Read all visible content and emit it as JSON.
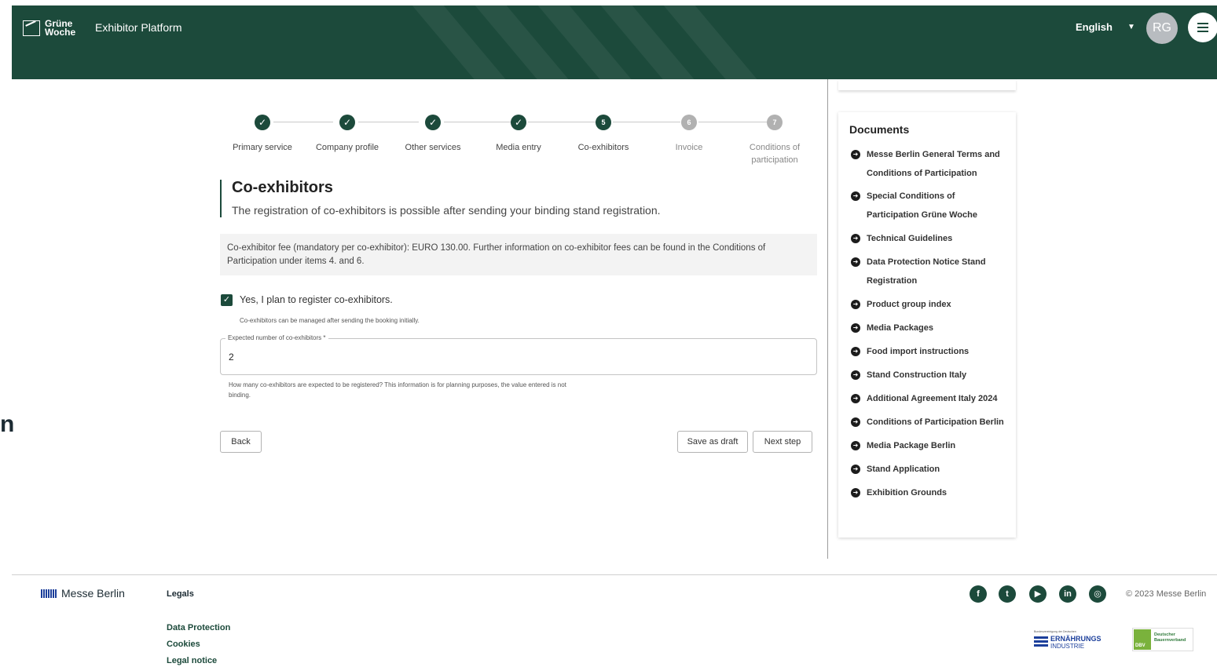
{
  "header": {
    "logo_line1": "Grüne",
    "logo_line2": "Woche",
    "platform": "Exhibitor Platform",
    "language": "English",
    "avatar_initials": "RG",
    "brand_color": "#1c4a3b"
  },
  "page_fragment_left": "n",
  "stepper": {
    "steps": [
      {
        "label": "Primary service",
        "state": "done"
      },
      {
        "label": "Company profile",
        "state": "done"
      },
      {
        "label": "Other services",
        "state": "done"
      },
      {
        "label": "Media entry",
        "state": "done"
      },
      {
        "label": "Co-exhibitors",
        "number": "5",
        "state": "current"
      },
      {
        "label": "Invoice",
        "number": "6",
        "state": "todo"
      },
      {
        "label_line1": "Conditions of",
        "label_line2": "participation",
        "number": "7",
        "state": "todo"
      }
    ]
  },
  "section": {
    "title": "Co-exhibitors",
    "description": "The registration of co-exhibitors is possible after sending your binding stand registration.",
    "fee_text": "Co-exhibitor fee (mandatory per co-exhibitor): EURO 130.00. Further information on co-exhibitor fees can be found in the Conditions of Participation under items 4. and 6.",
    "checkbox_label": "Yes, I plan to register co-exhibitors.",
    "checkbox_checked": true,
    "checkbox_hint": "Co-exhibitors can be managed after sending the booking initially.",
    "field_label": "Expected number of co-exhibitors *",
    "field_value": "2",
    "field_help_line1": "How many co-exhibitors are expected to be registered? This information is for planning purposes, the value entered is not",
    "field_help_line2": "binding."
  },
  "buttons": {
    "back": "Back",
    "save_draft": "Save as draft",
    "next": "Next step"
  },
  "documents": {
    "title": "Documents",
    "items": [
      {
        "line1": "Messe Berlin General Terms and",
        "line2": "Conditions of Participation"
      },
      {
        "line1": "Special Conditions of",
        "line2": "Participation Grüne Woche"
      },
      {
        "line1": "Technical Guidelines"
      },
      {
        "line1": "Data Protection Notice Stand",
        "line2": "Registration"
      },
      {
        "line1": "Product group index"
      },
      {
        "line1": "Media Packages"
      },
      {
        "line1": "Food import instructions"
      },
      {
        "line1": "Stand Construction Italy"
      },
      {
        "line1": "Additional Agreement Italy 2024"
      },
      {
        "line1": "Conditions of Participation Berlin"
      },
      {
        "line1": "Media Package Berlin"
      },
      {
        "line1": "Stand Application"
      },
      {
        "line1": "Exhibition Grounds"
      }
    ]
  },
  "footer": {
    "logo_text": "Messe Berlin",
    "legals": "Legals",
    "links": [
      "Data Protection",
      "Cookies",
      "Legal notice"
    ],
    "social": [
      "facebook-icon",
      "twitter-icon",
      "youtube-icon",
      "linkedin-icon",
      "instagram-icon"
    ],
    "copyright": "© 2023 Messe Berlin",
    "partner1_small": "Bundesvereinigung der Deutschen",
    "partner1_line1": "ERNÄHRUNGS",
    "partner1_line2": "INDUSTRIE",
    "partner2_mark": "DBV",
    "partner2_line1": "Deutscher",
    "partner2_line2": "Bauernverband"
  }
}
